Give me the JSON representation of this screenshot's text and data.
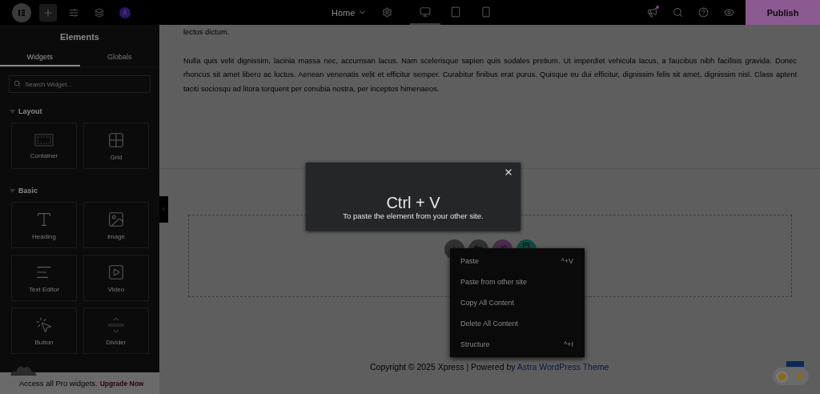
{
  "topbar": {
    "page_selector": "Home",
    "devices": [
      {
        "kind": "desktop",
        "selected": true
      },
      {
        "kind": "tablet",
        "selected": false
      },
      {
        "kind": "mobile",
        "selected": false
      }
    ],
    "notification": true,
    "publish": "Publish"
  },
  "sidebar": {
    "title": "Elements",
    "tabs": [
      {
        "label": "Widgets",
        "selected": true
      },
      {
        "label": "Globals",
        "selected": false
      }
    ],
    "search": {
      "placeholder": "Search Widget..."
    },
    "sections": [
      {
        "title": "Layout",
        "expanded": true,
        "widgets": [
          {
            "label": "Container",
            "kind": "container"
          },
          {
            "label": "Grid",
            "kind": "grid"
          }
        ]
      },
      {
        "title": "Basic",
        "expanded": true,
        "widgets": [
          {
            "label": "Heading",
            "kind": "heading"
          },
          {
            "label": "Image",
            "kind": "image"
          },
          {
            "label": "Text Editor",
            "kind": "text"
          },
          {
            "label": "Video",
            "kind": "video"
          },
          {
            "label": "Button",
            "kind": "button"
          },
          {
            "label": "Divider",
            "kind": "divider"
          }
        ]
      }
    ],
    "promo": {
      "text": "Access all Pro widgets.",
      "link": "Upgrade Now"
    }
  },
  "canvas": {
    "paragraphs": [
      "lectus dictum.",
      "Nulla quis velit dignissim, lacinia massa nec, accumsan lacus. Nam scelerisque sapien quis sodales pretium. Ut imperdiet vehicula lacus, a faucibus nibh facilisis gravida. Donec rhoncus sit amet libero ac luctus. Aenean venenatis velit et efficitur semper. Curabitur finibus erat purus. Quisque eu dui efficitur, dignissim felis sit amet, dignissim nisl. Class aptent taciti sociosqu ad litora torquent per conubia nostra, per inceptos himenaeos."
    ],
    "add_buttons": [
      {
        "kind": "add"
      },
      {
        "kind": "template"
      },
      {
        "kind": "ai"
      },
      {
        "kind": "kit"
      }
    ],
    "footer": {
      "text": "Copyright © 2025 Xpress | Powered by ",
      "link": "Astra WordPress Theme"
    }
  },
  "paste_dialog": {
    "title": "Ctrl + V",
    "message": "To paste the element from your other site."
  },
  "theme_toggle": {
    "on": false
  },
  "context_menu": {
    "items": [
      {
        "label": "Paste",
        "shortcut": "^+V"
      },
      {
        "label": "Paste from other site"
      },
      {
        "label": "Copy All Content"
      },
      {
        "label": "Delete All Content"
      },
      {
        "label": "Structure",
        "shortcut": "^+I"
      }
    ]
  }
}
